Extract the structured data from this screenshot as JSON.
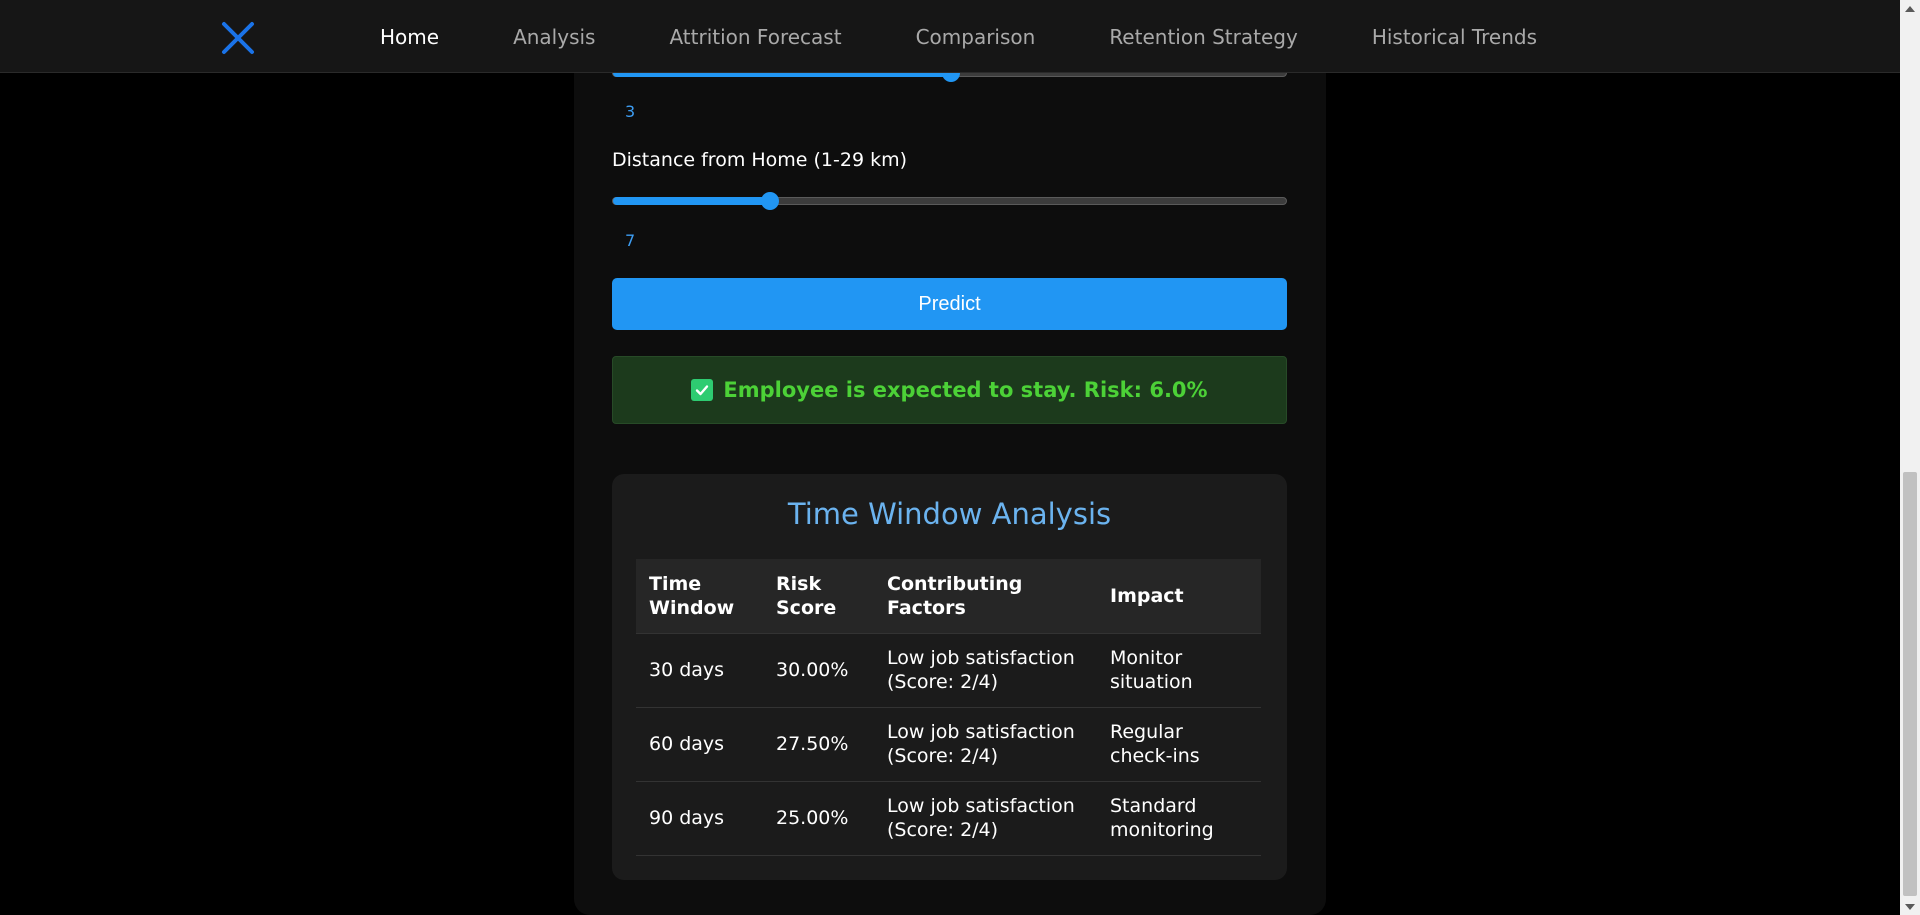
{
  "nav": {
    "logo": "X",
    "links": [
      "Home",
      "Analysis",
      "Attrition Forecast",
      "Comparison",
      "Retention Strategy",
      "Historical Trends"
    ],
    "active": "Home"
  },
  "form": {
    "prev_slider": {
      "value": "3",
      "fill_fraction": 0.5
    },
    "distance": {
      "label": "Distance from Home (1-29 km)",
      "value": "7",
      "min": 1,
      "max": 29,
      "fill_fraction": 0.23
    },
    "predict_label": "Predict"
  },
  "result": {
    "icon": "check-icon",
    "text": "Employee is expected to stay. Risk: 6.0%",
    "color": "#4cd137"
  },
  "analysis": {
    "title": "Time Window Analysis",
    "headers": [
      "Time Window",
      "Risk Score",
      "Contributing Factors",
      "Impact"
    ],
    "rows": [
      [
        "30 days",
        "30.00%",
        "Low job satisfaction (Score: 2/4)",
        "Monitor situation"
      ],
      [
        "60 days",
        "27.50%",
        "Low job satisfaction (Score: 2/4)",
        "Regular check-ins"
      ],
      [
        "90 days",
        "25.00%",
        "Low job satisfaction (Score: 2/4)",
        "Standard monitoring"
      ]
    ]
  },
  "colors": {
    "accent": "#2196f3",
    "title": "#6bb3ef",
    "success_bg": "#1c3a1c"
  }
}
